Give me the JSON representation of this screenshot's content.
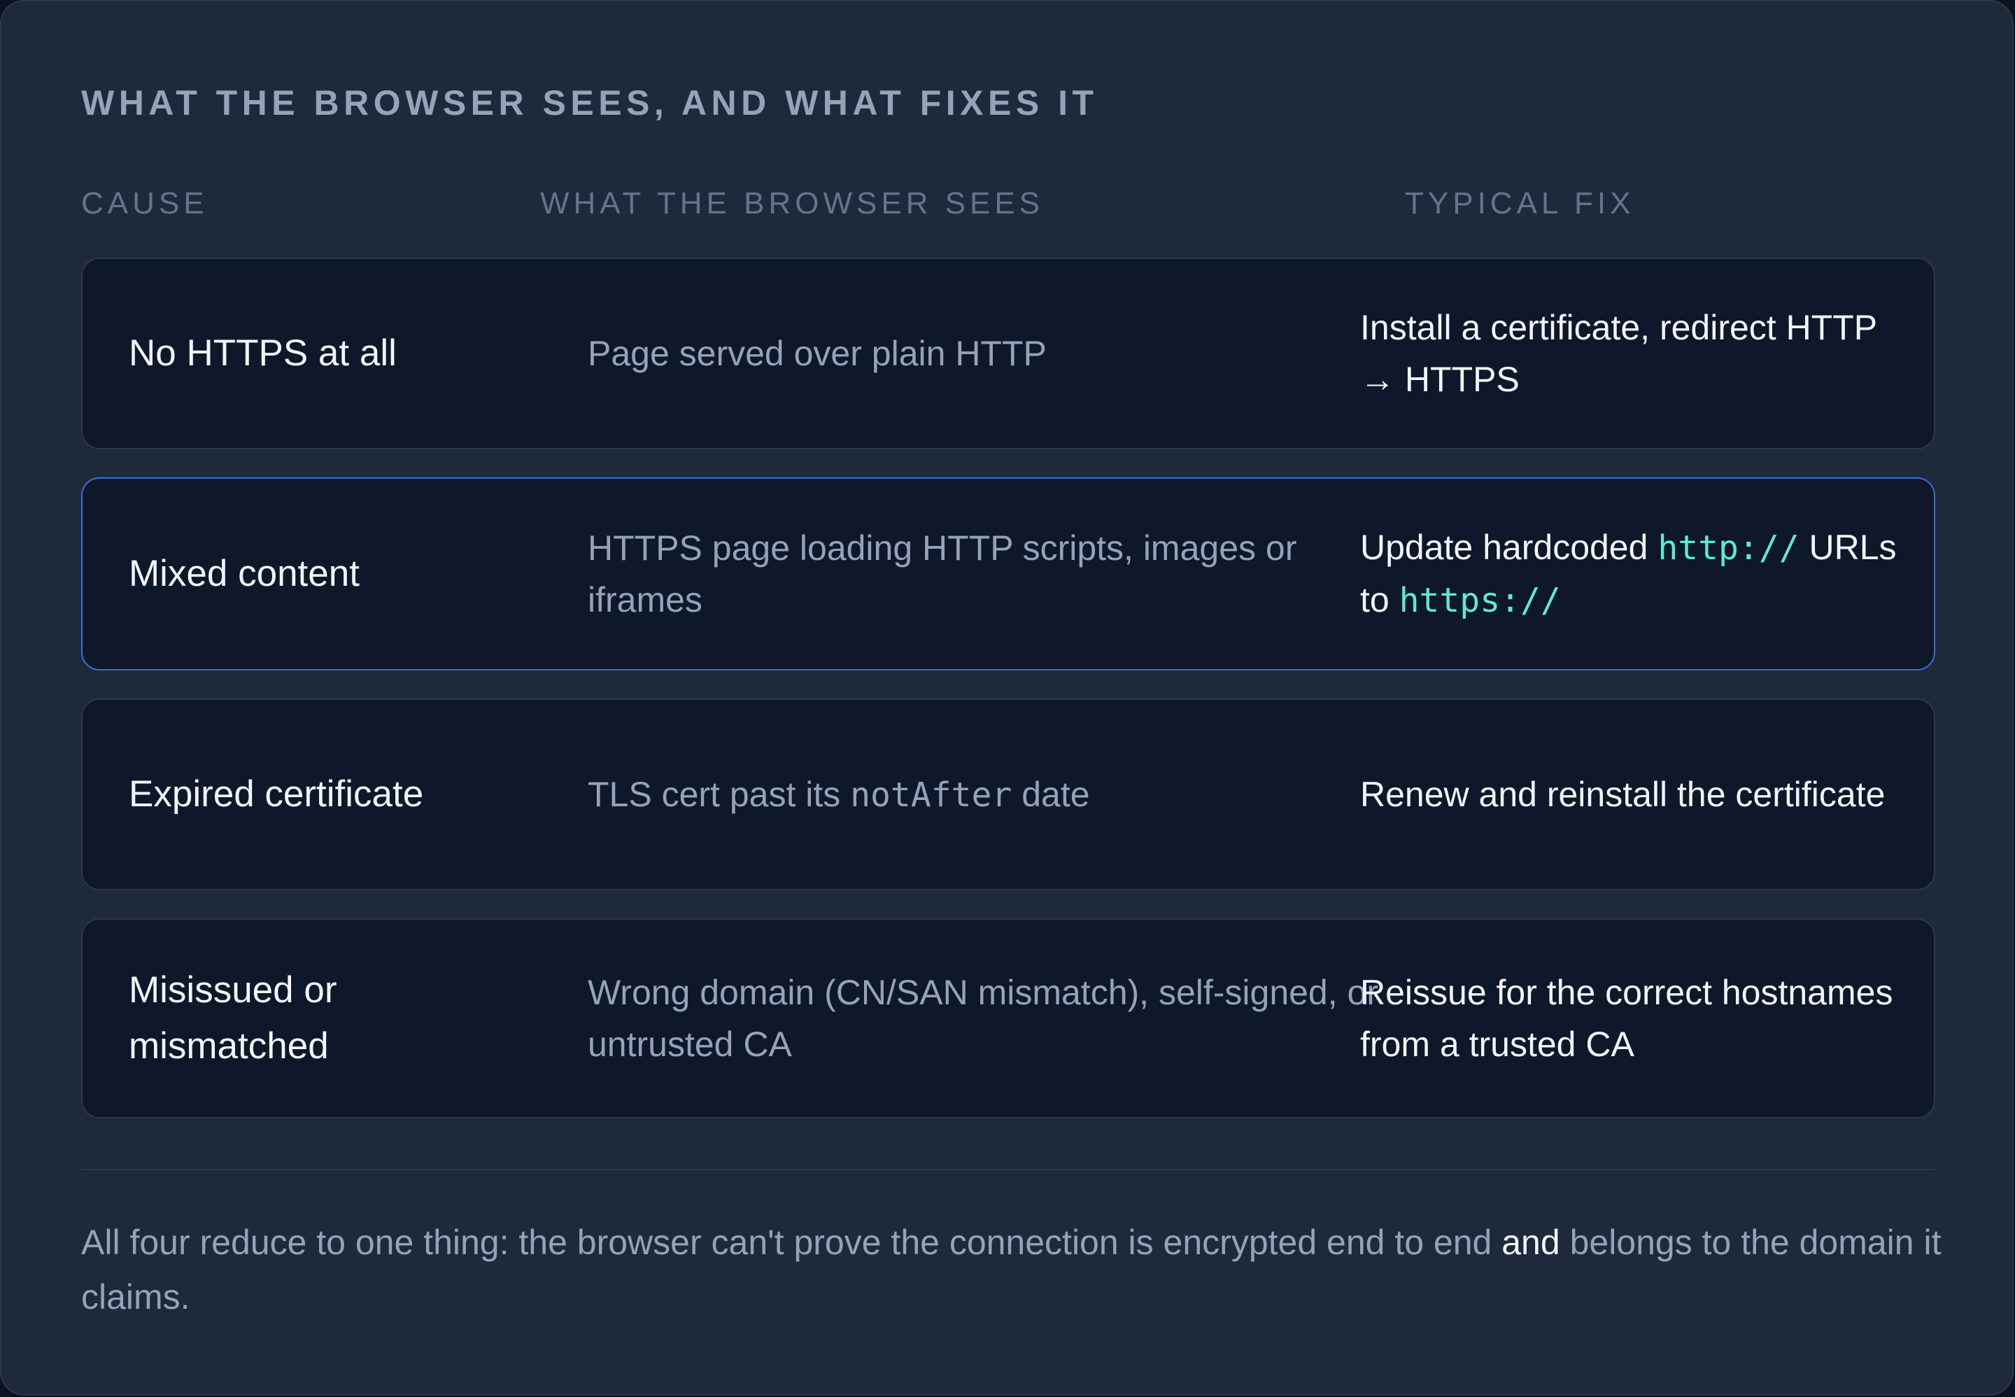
{
  "panel": {
    "title": "WHAT THE BROWSER SEES, AND WHAT FIXES IT"
  },
  "table": {
    "headers": {
      "cause": "CAUSE",
      "sees": "WHAT THE BROWSER SEES",
      "fix": "TYPICAL FIX"
    },
    "rows": [
      {
        "cause": "No HTTPS at all",
        "sees": "Page served over plain HTTP",
        "fix": "Install a certificate, redirect HTTP → HTTPS"
      },
      {
        "cause": "Mixed content",
        "sees": "HTTPS page loading HTTP scripts, images or iframes",
        "fix_pre": "Update hardcoded ",
        "fix_code1": "http://",
        "fix_mid": " URLs to ",
        "fix_code2": "https://"
      },
      {
        "cause": "Expired certificate",
        "sees_pre": "TLS cert past its ",
        "sees_code": "notAfter",
        "sees_post": " date",
        "fix": "Renew and reinstall the certificate"
      },
      {
        "cause": "Misissued or mismatched",
        "sees": "Wrong domain (CN/SAN mismatch), self-signed, or untrusted CA",
        "fix": "Reissue for the correct hostnames from a trusted CA"
      }
    ]
  },
  "footer": {
    "pre": "All four reduce to one thing: the browser can't prove the connection is encrypted end to end ",
    "emphasis": "and",
    "post": " belongs to the domain it claims."
  },
  "colors": {
    "background": "#1e293b",
    "row_background": "#0f172a",
    "highlight_border": "#3b6fd8",
    "code_accent": "#5eead4"
  }
}
